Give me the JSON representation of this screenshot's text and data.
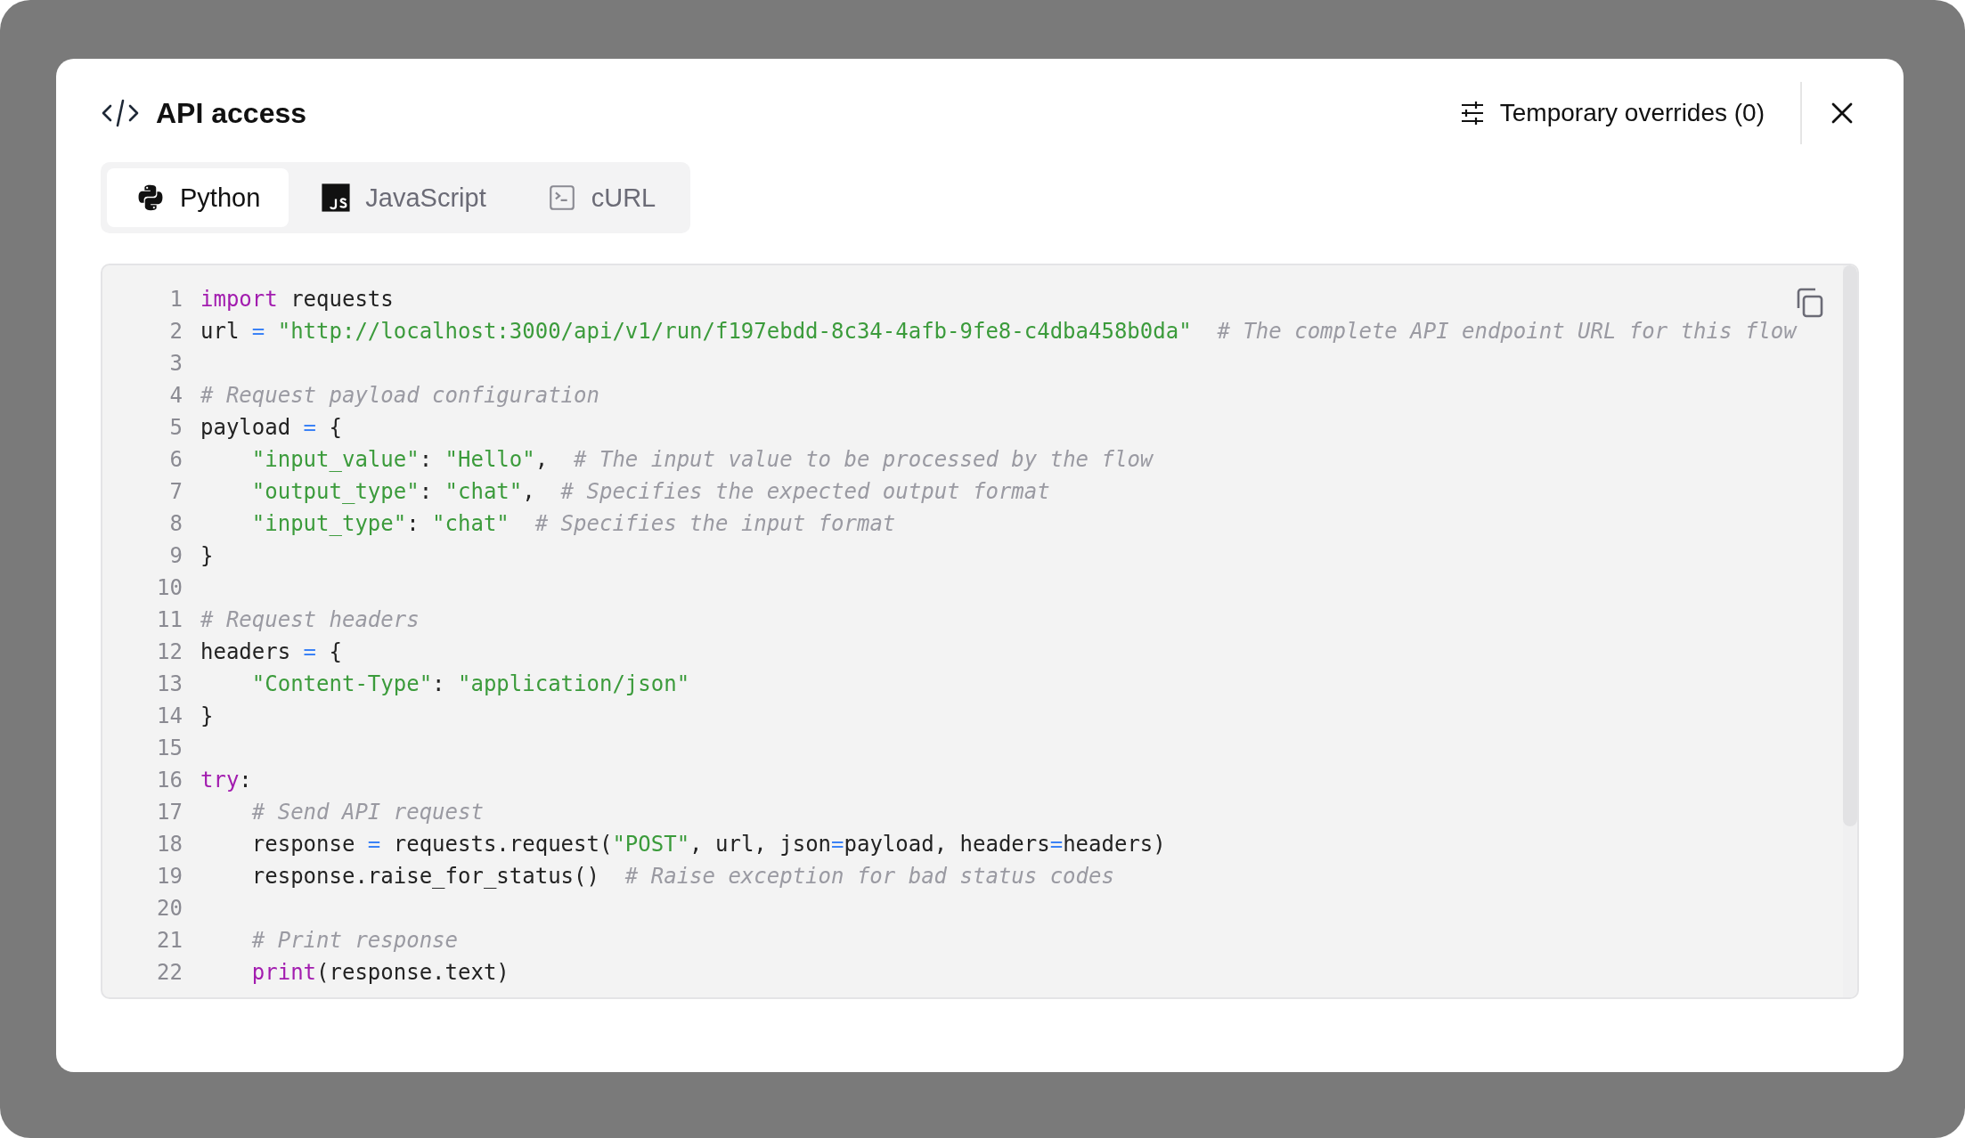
{
  "dialog": {
    "title": "API access",
    "overrides_button": "Temporary overrides (0)"
  },
  "tabs": [
    {
      "label": "Python",
      "selected": true
    },
    {
      "label": "JavaScript",
      "selected": false
    },
    {
      "label": "cURL",
      "selected": false
    }
  ],
  "code": {
    "lines": [
      {
        "number": "1",
        "tokens": [
          {
            "kind": "keyword",
            "text": "import"
          },
          {
            "kind": "plain",
            "text": " requests"
          }
        ]
      },
      {
        "number": "2",
        "tokens": [
          {
            "kind": "plain",
            "text": "url "
          },
          {
            "kind": "operator",
            "text": "="
          },
          {
            "kind": "string",
            "text": " \"http://localhost:3000/api/v1/run/f197ebdd-8c34-4afb-9fe8-c4dba458b0da\""
          },
          {
            "kind": "comment",
            "text": "  # The complete API endpoint URL for this flow"
          }
        ]
      },
      {
        "number": "3"
      },
      {
        "number": "4",
        "tokens": [
          {
            "kind": "comment",
            "text": "# Request payload configuration"
          }
        ]
      },
      {
        "number": "5",
        "tokens": [
          {
            "kind": "plain",
            "text": "payload "
          },
          {
            "kind": "operator",
            "text": "="
          },
          {
            "kind": "plain",
            "text": " {"
          }
        ]
      },
      {
        "number": "6",
        "tokens": [
          {
            "kind": "string",
            "text": "    \"input_value\""
          },
          {
            "kind": "plain",
            "text": ": "
          },
          {
            "kind": "string",
            "text": "\"Hello\""
          },
          {
            "kind": "plain",
            "text": ",  "
          },
          {
            "kind": "comment",
            "text": "# The input value to be processed by the flow"
          }
        ]
      },
      {
        "number": "7",
        "tokens": [
          {
            "kind": "string",
            "text": "    \"output_type\""
          },
          {
            "kind": "plain",
            "text": ": "
          },
          {
            "kind": "string",
            "text": "\"chat\""
          },
          {
            "kind": "plain",
            "text": ",  "
          },
          {
            "kind": "comment",
            "text": "# Specifies the expected output format"
          }
        ]
      },
      {
        "number": "8",
        "tokens": [
          {
            "kind": "string",
            "text": "    \"input_type\""
          },
          {
            "kind": "plain",
            "text": ": "
          },
          {
            "kind": "string",
            "text": "\"chat\""
          },
          {
            "kind": "comment",
            "text": "  # Specifies the input format"
          }
        ]
      },
      {
        "number": "9",
        "tokens": [
          {
            "kind": "plain",
            "text": "}"
          }
        ]
      },
      {
        "number": "10"
      },
      {
        "number": "11",
        "tokens": [
          {
            "kind": "comment",
            "text": "# Request headers"
          }
        ]
      },
      {
        "number": "12",
        "tokens": [
          {
            "kind": "plain",
            "text": "headers "
          },
          {
            "kind": "operator",
            "text": "="
          },
          {
            "kind": "plain",
            "text": " {"
          }
        ]
      },
      {
        "number": "13",
        "tokens": [
          {
            "kind": "string",
            "text": "    \"Content-Type\""
          },
          {
            "kind": "plain",
            "text": ": "
          },
          {
            "kind": "string",
            "text": "\"application/json\""
          }
        ]
      },
      {
        "number": "14",
        "tokens": [
          {
            "kind": "plain",
            "text": "}"
          }
        ]
      },
      {
        "number": "15"
      },
      {
        "number": "16",
        "tokens": [
          {
            "kind": "keyword",
            "text": "try"
          },
          {
            "kind": "plain",
            "text": ":"
          }
        ]
      },
      {
        "number": "17",
        "tokens": [
          {
            "kind": "comment",
            "text": "    # Send API request"
          }
        ]
      },
      {
        "number": "18",
        "tokens": [
          {
            "kind": "plain",
            "text": "    response "
          },
          {
            "kind": "operator",
            "text": "="
          },
          {
            "kind": "plain",
            "text": " requests.request("
          },
          {
            "kind": "string",
            "text": "\"POST\""
          },
          {
            "kind": "plain",
            "text": ", url, json"
          },
          {
            "kind": "operator",
            "text": "="
          },
          {
            "kind": "plain",
            "text": "payload, headers"
          },
          {
            "kind": "operator",
            "text": "="
          },
          {
            "kind": "plain",
            "text": "headers)"
          }
        ]
      },
      {
        "number": "19",
        "tokens": [
          {
            "kind": "plain",
            "text": "    response.raise_for_status()  "
          },
          {
            "kind": "comment",
            "text": "# Raise exception for bad status codes"
          }
        ]
      },
      {
        "number": "20"
      },
      {
        "number": "21",
        "tokens": [
          {
            "kind": "comment",
            "text": "    # Print response"
          }
        ]
      },
      {
        "number": "22",
        "tokens": [
          {
            "kind": "keyword",
            "text": "    print"
          },
          {
            "kind": "plain",
            "text": "(response.text)"
          }
        ]
      }
    ]
  }
}
